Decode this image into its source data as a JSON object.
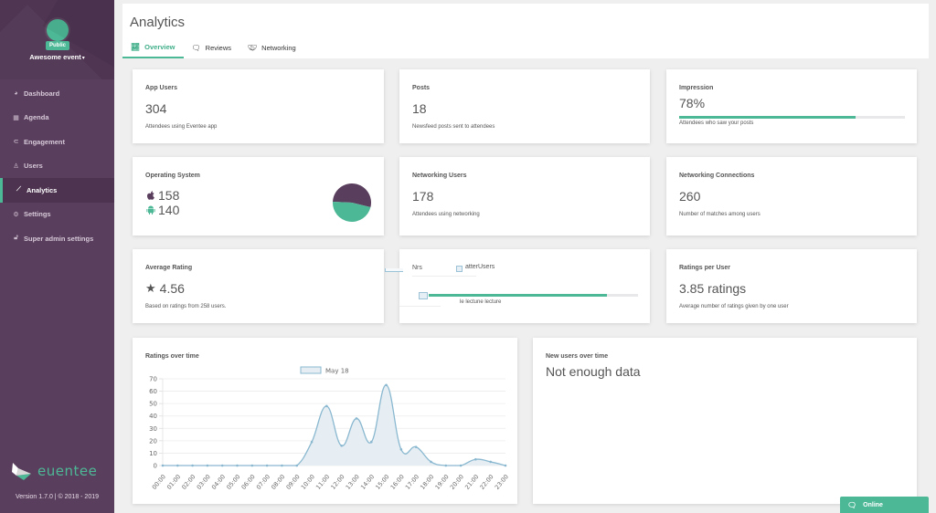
{
  "sidebar": {
    "event_badge": "Public",
    "event_name": "Awesome event",
    "items": [
      {
        "label": "Dashboard",
        "icon": "dashboard-icon"
      },
      {
        "label": "Agenda",
        "icon": "calendar-icon"
      },
      {
        "label": "Engagement",
        "icon": "magnet-icon"
      },
      {
        "label": "Users",
        "icon": "users-icon"
      },
      {
        "label": "Analytics",
        "icon": "line-chart-icon",
        "active": true
      },
      {
        "label": "Settings",
        "icon": "gear-icon"
      },
      {
        "label": "Super admin settings",
        "icon": "lock-icon"
      }
    ],
    "logo_text": "euentee",
    "version": "Version 1.7.0 | © 2018 - 2019"
  },
  "header": {
    "title": "Analytics",
    "tabs": [
      {
        "label": "Overview",
        "icon": "line-chart-icon",
        "active": true
      },
      {
        "label": "Reviews",
        "icon": "comments-icon"
      },
      {
        "label": "Networking",
        "icon": "handshake-icon"
      }
    ]
  },
  "cards": {
    "app_users": {
      "title": "App Users",
      "value": "304",
      "desc": "Attendees using Eventee app"
    },
    "posts": {
      "title": "Posts",
      "value": "18",
      "desc": "Newsfeed posts sent to attendees"
    },
    "impression": {
      "title": "Impression",
      "value": "78%",
      "progress": 0.78,
      "desc": "Attendees who saw your posts"
    },
    "operating_system": {
      "title": "Operating System",
      "ios": "158",
      "android": "140",
      "colors": {
        "ios": "#5a3e5d",
        "android": "#4db896"
      }
    },
    "networking_users": {
      "title": "Networking Users",
      "value": "178",
      "desc": "Attendees using networking"
    },
    "networking_connections": {
      "title": "Networking Connections",
      "value": "260",
      "desc": "Number of matches among users"
    },
    "average_rating": {
      "title": "Average Rating",
      "value": "4.56",
      "desc": "Based on ratings from 258 users."
    },
    "glitched": {
      "title": "Nrs",
      "legend": "atterUsers",
      "progress": 0.85,
      "desc": "le lectune lecture"
    },
    "ratings_per_user": {
      "title": "Ratings per User",
      "value": "3.85 ratings",
      "desc": "Average number of ratings given by one user"
    },
    "ratings_over_time": {
      "title": "Ratings over time"
    },
    "new_users": {
      "title": "New users over time",
      "empty": "Not enough data"
    }
  },
  "chart_data": {
    "type": "area",
    "title": "Ratings over time",
    "legend": [
      "May 18"
    ],
    "legend_position": "top",
    "categories": [
      "00:00",
      "01:00",
      "02:00",
      "03:00",
      "04:00",
      "05:00",
      "06:00",
      "07:00",
      "08:00",
      "09:00",
      "10:00",
      "11:00",
      "12:00",
      "13:00",
      "14:00",
      "15:00",
      "16:00",
      "17:00",
      "18:00",
      "19:00",
      "20:00",
      "21:00",
      "22:00",
      "23:00"
    ],
    "series": [
      {
        "name": "May 18",
        "values": [
          0,
          0,
          0,
          0,
          0,
          0,
          0,
          0,
          0,
          0,
          19,
          48,
          16,
          38,
          19,
          65,
          13,
          15,
          3,
          0,
          0,
          5,
          3,
          0
        ]
      }
    ],
    "ylim": [
      0,
      70
    ],
    "yticks": [
      0,
      10,
      20,
      30,
      40,
      50,
      60,
      70
    ],
    "grid": true,
    "xlabel": "",
    "ylabel": "",
    "colors": {
      "line": "#8ab8d0",
      "fill": "#e6eef3"
    }
  },
  "status": {
    "online": "Online"
  }
}
